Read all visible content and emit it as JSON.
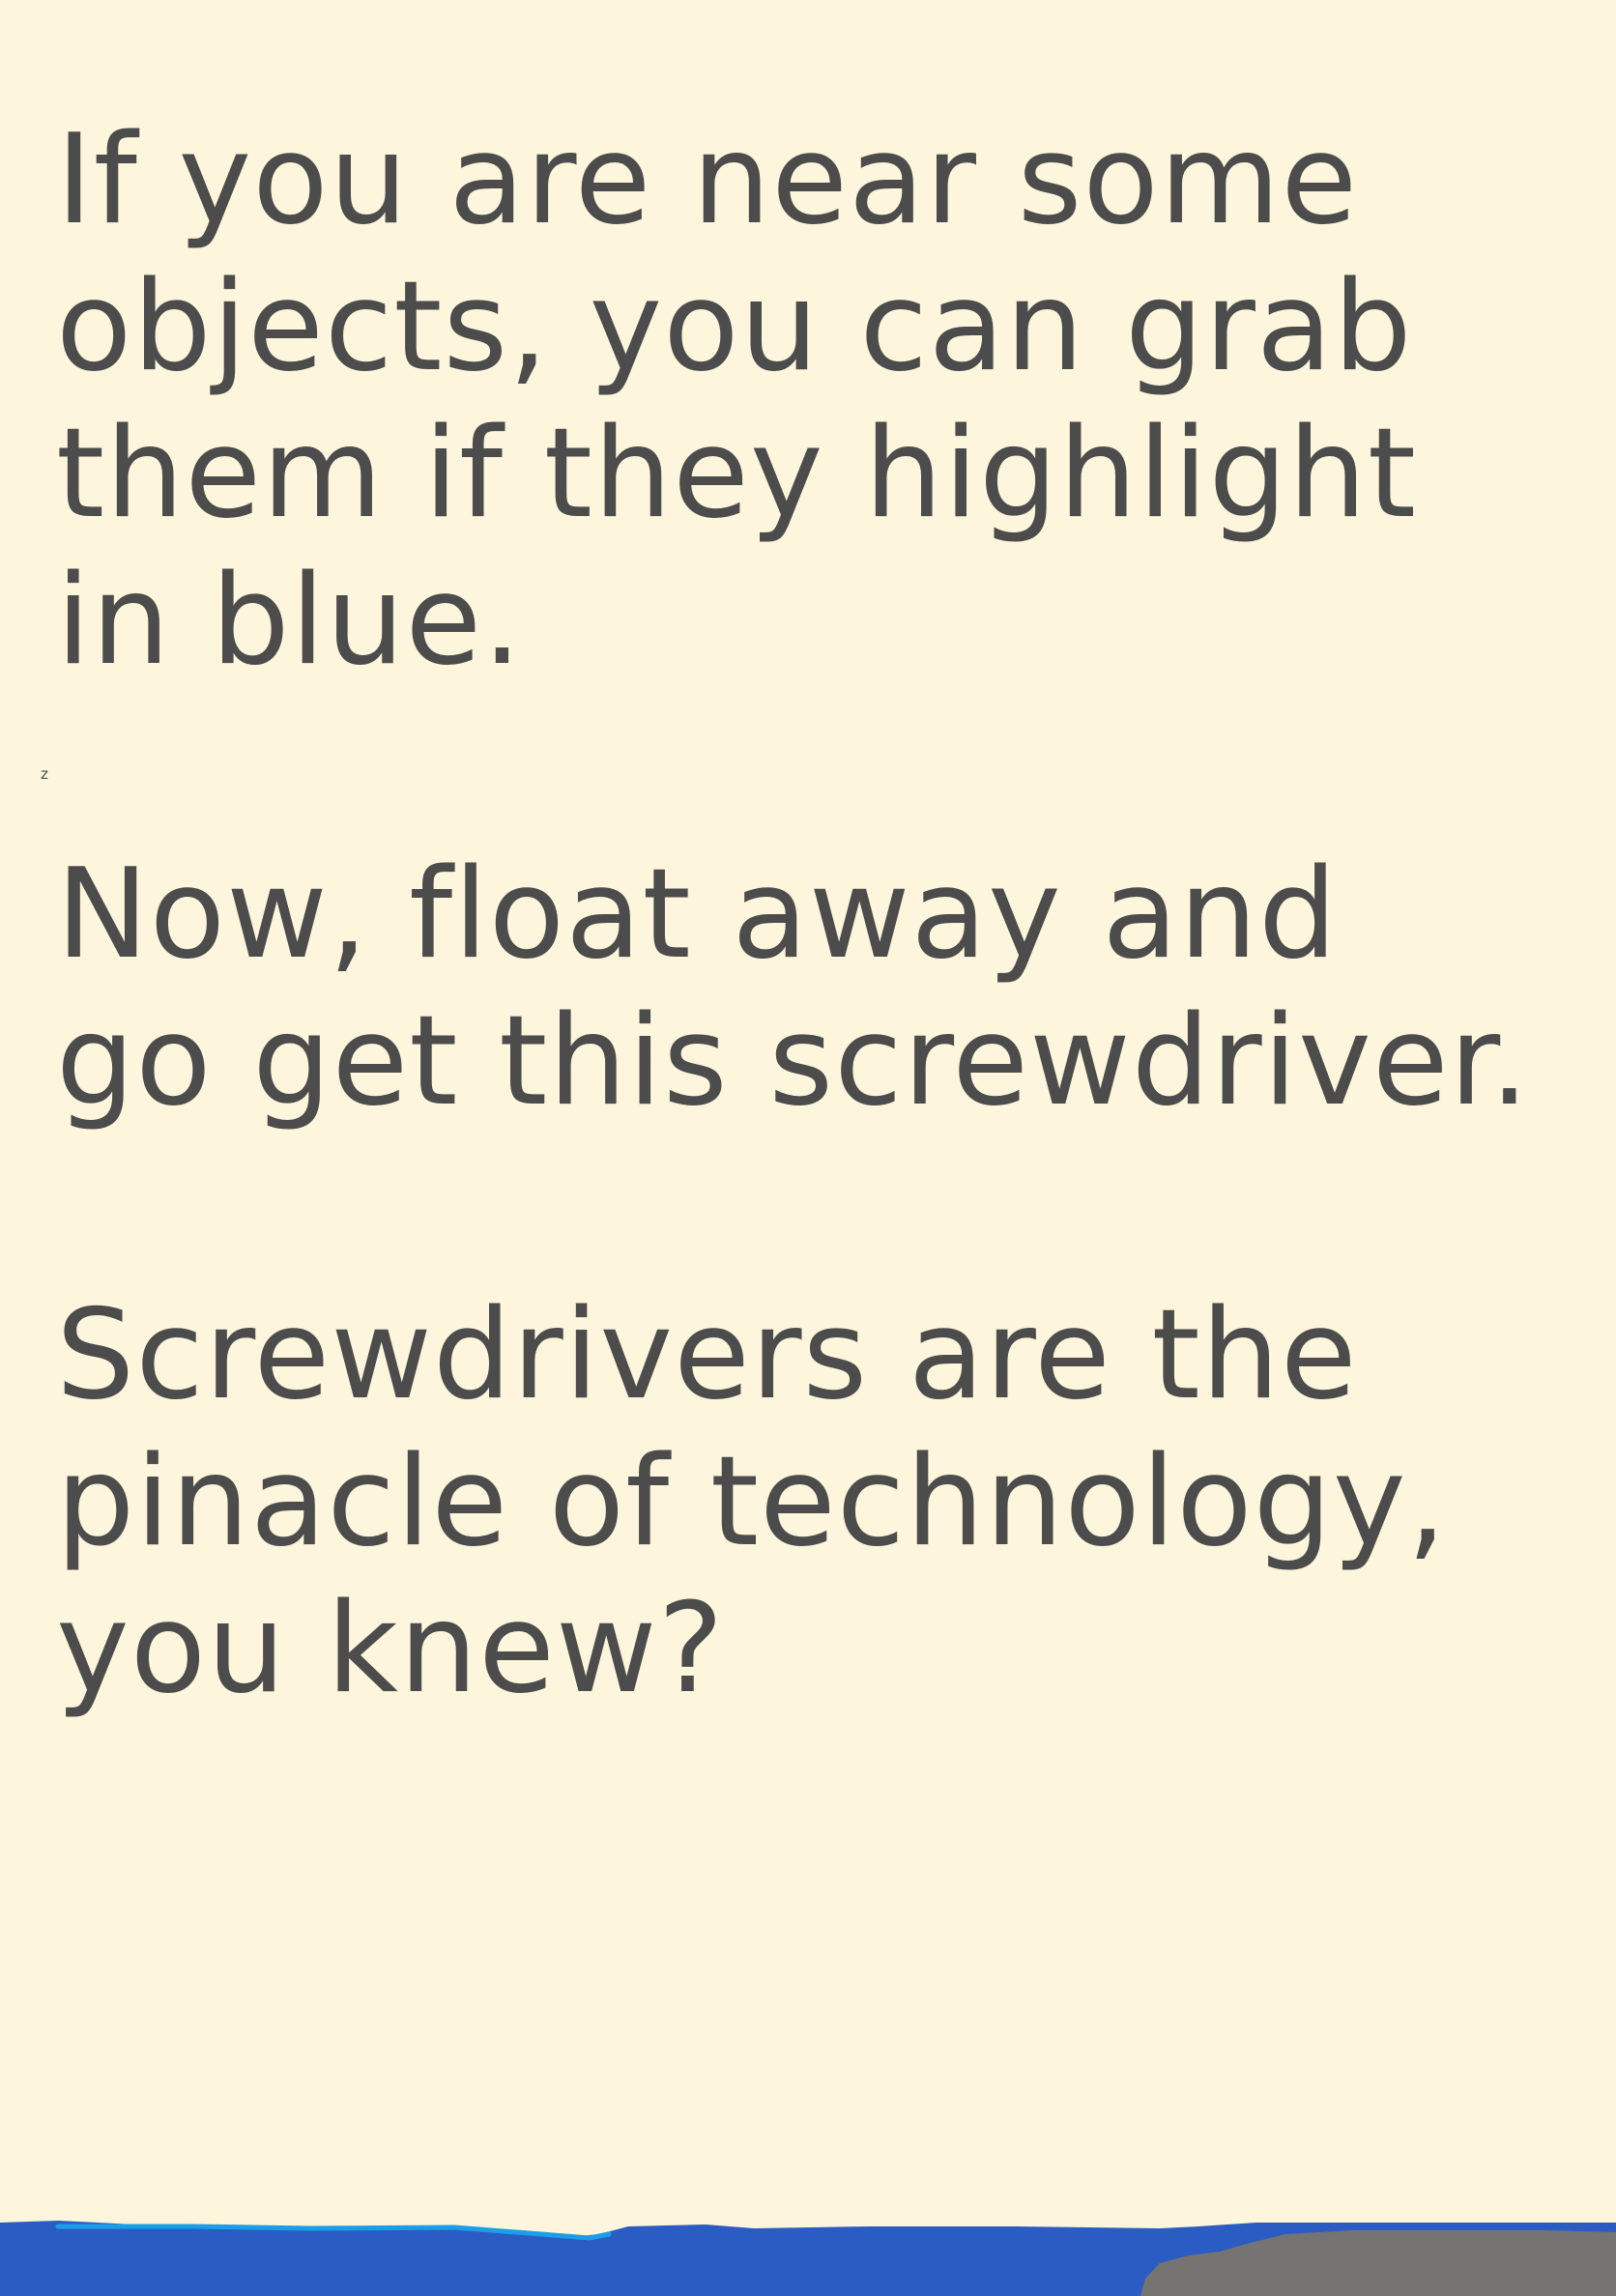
{
  "dialog": {
    "paragraphs": [
      "If you are near some\nobjects, you can grab\nthem if they highlight\nin blue.",
      "Now, float away and\ngo get this screwdriver.",
      "Screwdrivers are the\npinacle of technology,\nyou knew?"
    ],
    "key_hint": "z"
  },
  "colors": {
    "background": "#fdf5dc",
    "text": "#4c4c4c",
    "water": "#2a5cc4",
    "water_highlight": "#1a9ee8",
    "rock": "#767472"
  }
}
